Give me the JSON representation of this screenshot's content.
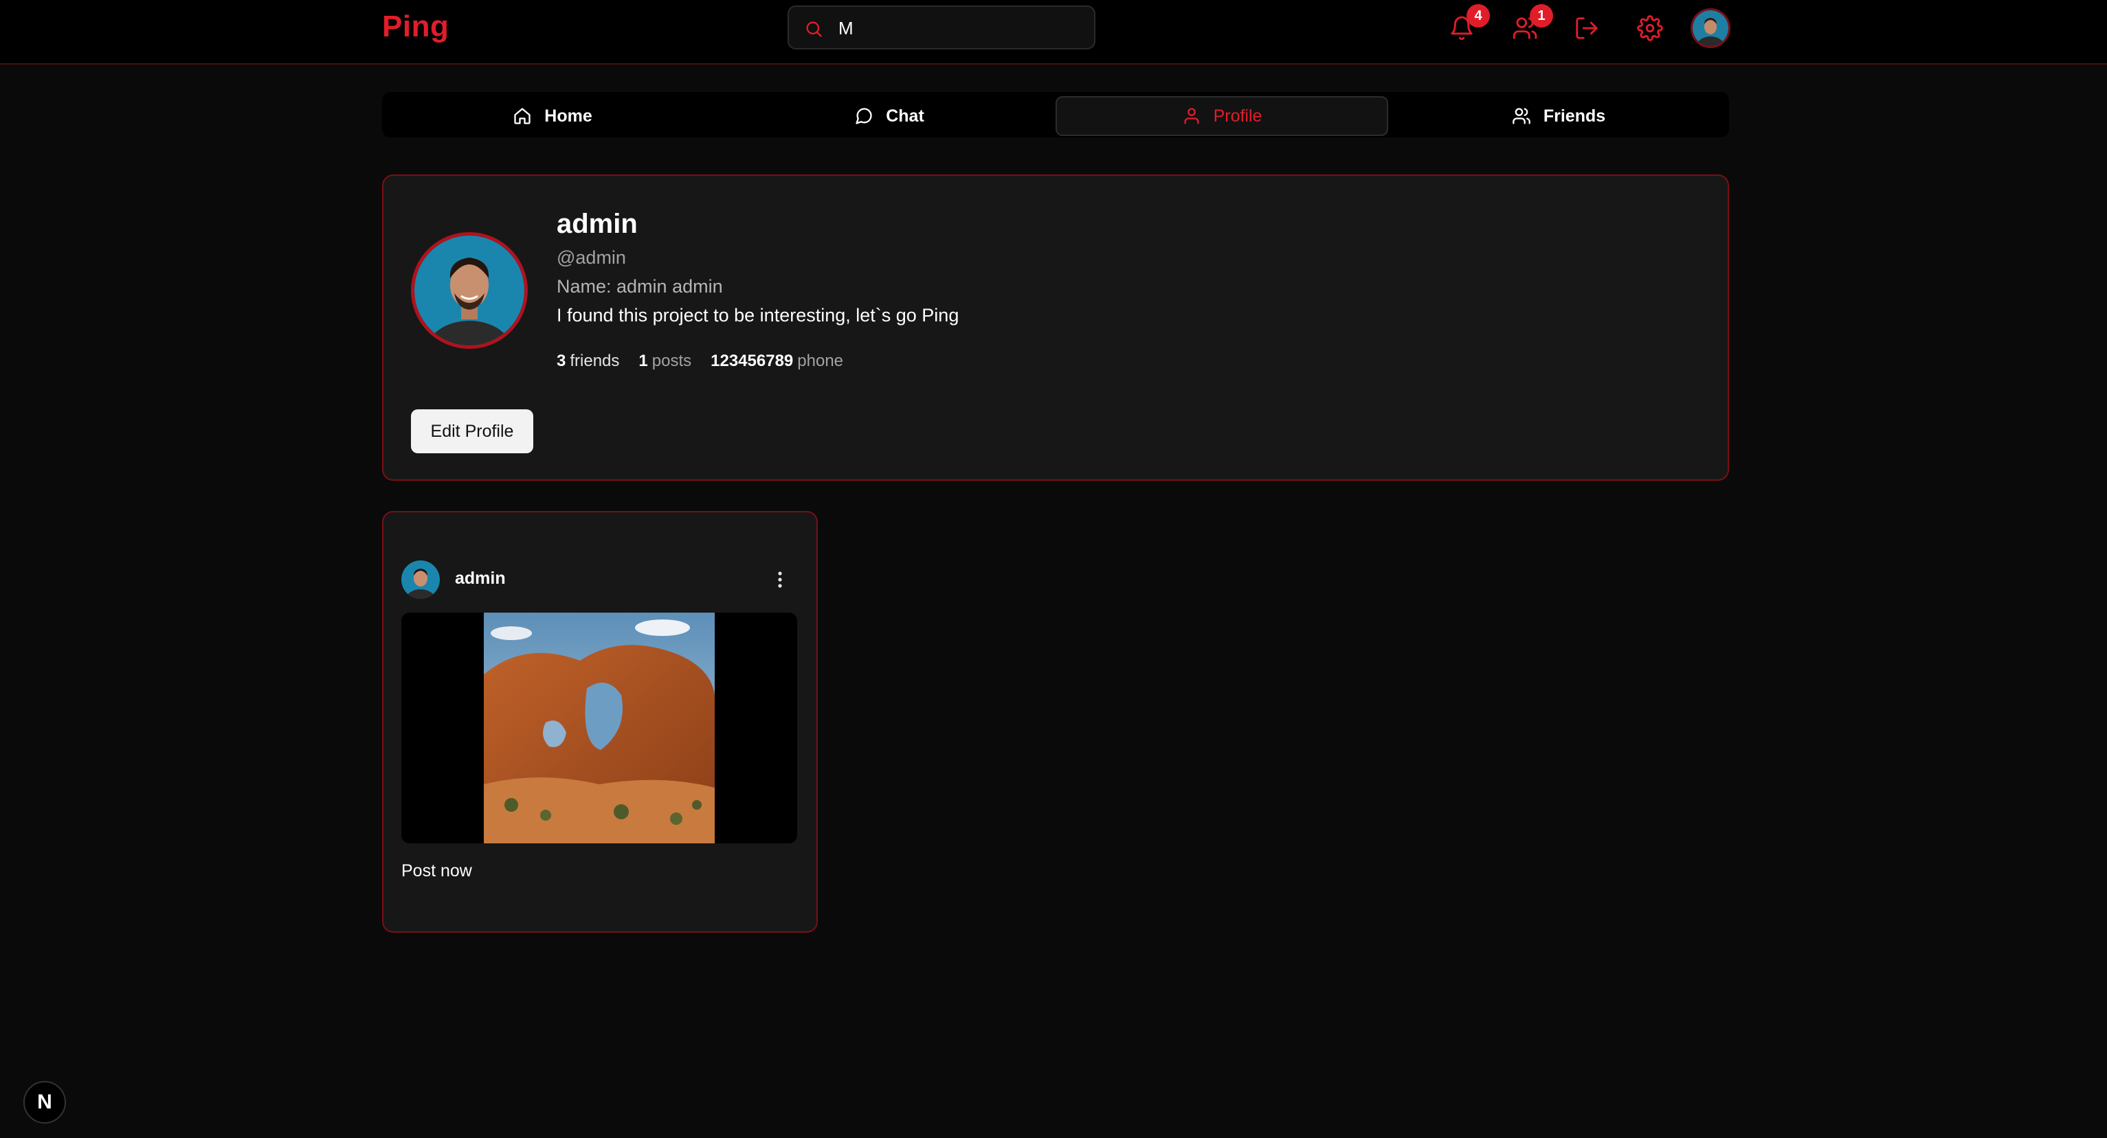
{
  "app": {
    "logo": "Ping"
  },
  "search": {
    "value": "M",
    "icon": "search-icon"
  },
  "header": {
    "notifications": {
      "icon": "bell-icon",
      "count": "4"
    },
    "friend_requests": {
      "icon": "users-icon",
      "count": "1"
    },
    "logout": {
      "icon": "logout-icon"
    },
    "settings": {
      "icon": "gear-icon"
    },
    "avatar": {
      "icon": "user-avatar"
    }
  },
  "tabs": [
    {
      "label": "Home",
      "icon": "home-icon",
      "active": false
    },
    {
      "label": "Chat",
      "icon": "chat-icon",
      "active": false
    },
    {
      "label": "Profile",
      "icon": "user-icon",
      "active": true
    },
    {
      "label": "Friends",
      "icon": "friends-icon",
      "active": false
    }
  ],
  "profile": {
    "name": "admin",
    "handle": "@admin",
    "full_name": "Name: admin admin",
    "bio": "I found this project to be interesting, let`s go Ping",
    "stats": {
      "friends_count": "3",
      "friends_label": "friends",
      "posts_count": "1",
      "posts_label": "posts",
      "phone_value": "123456789",
      "phone_label": "phone"
    },
    "edit_button": "Edit Profile"
  },
  "posts": [
    {
      "author": "admin",
      "caption": "Post now",
      "image": "desert-arch-photo",
      "menu_icon": "more-vertical-icon"
    }
  ],
  "corner_badge": "N",
  "colors": {
    "accent": "#e11d2a",
    "background": "#0a0a0a",
    "card": "#171717",
    "card_border": "#7a0f16"
  }
}
